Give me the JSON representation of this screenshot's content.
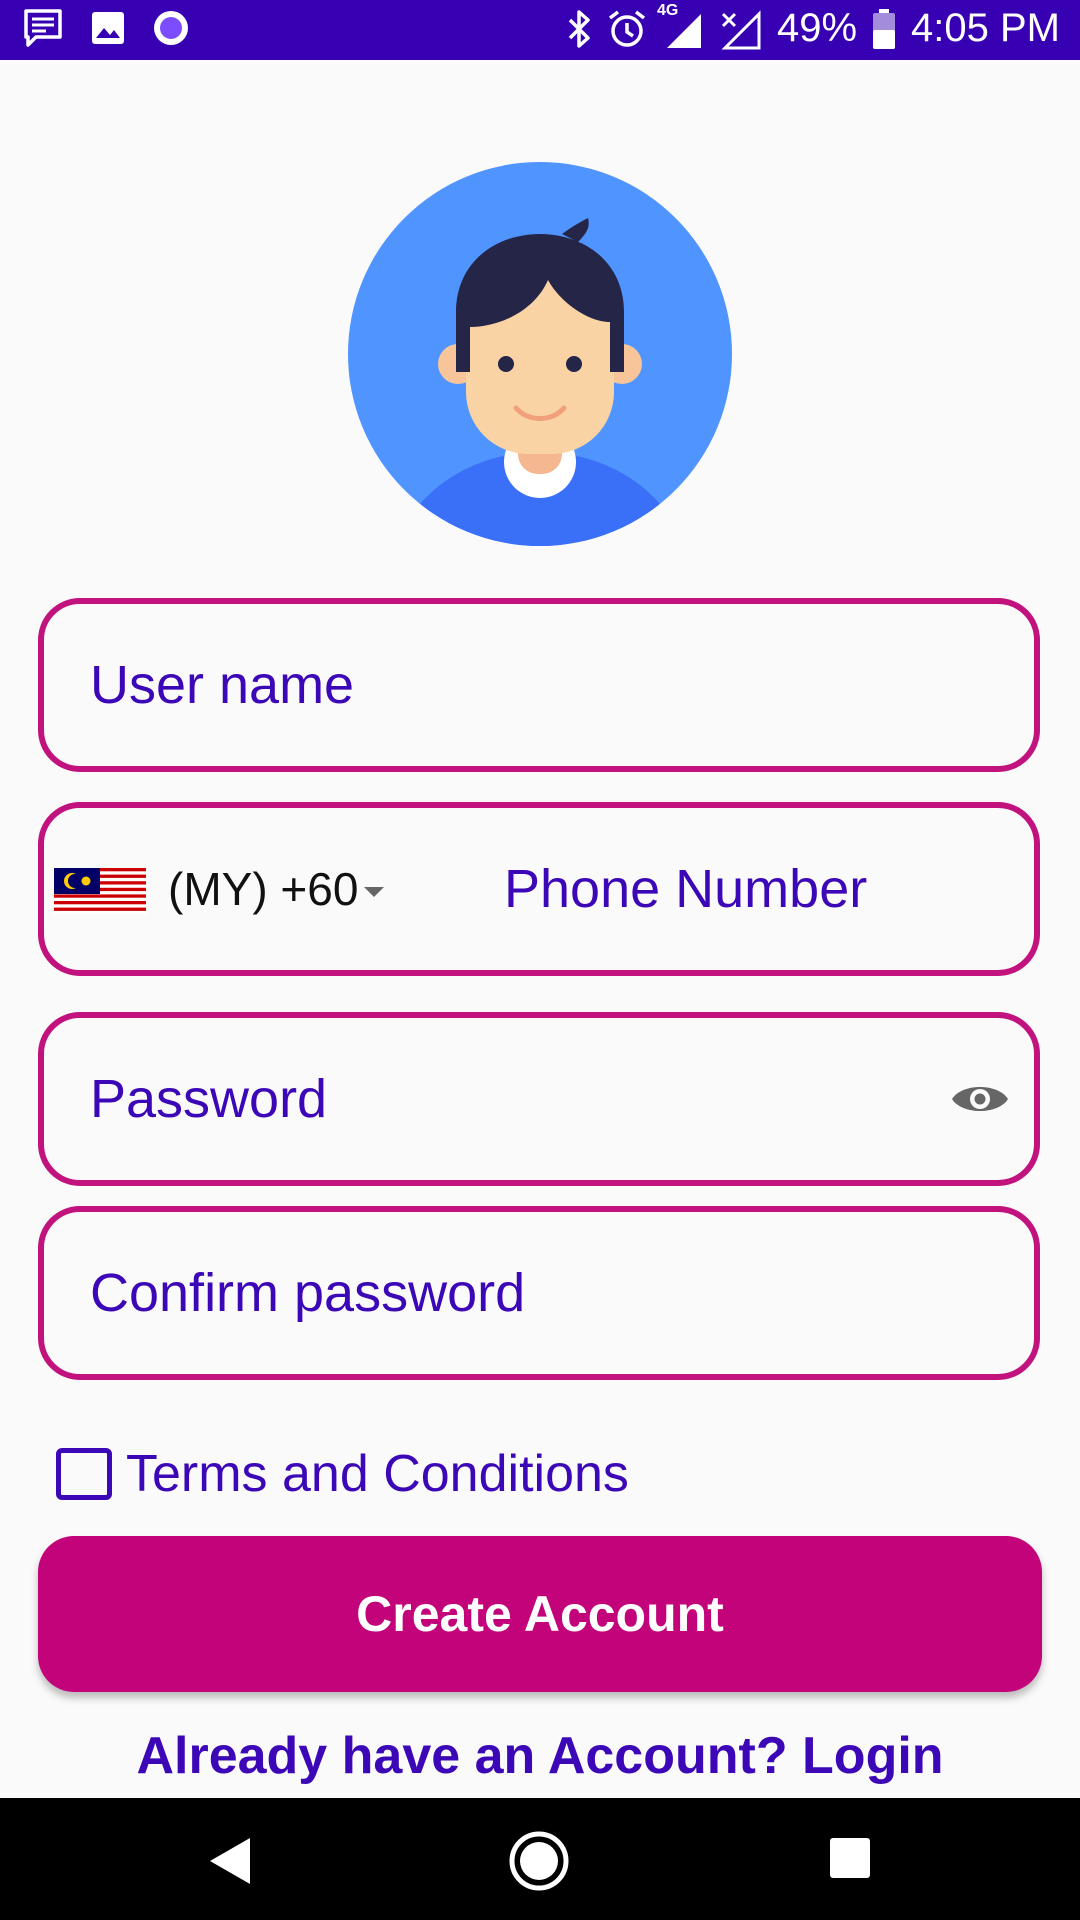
{
  "status_bar": {
    "battery": "49%",
    "time": "4:05 PM",
    "network": "4G",
    "icons": [
      "message-icon",
      "image-icon",
      "assistant-icon",
      "bluetooth-icon",
      "alarm-icon",
      "signal-icon",
      "signal-x-icon",
      "battery-icon"
    ]
  },
  "form": {
    "username_placeholder": "User name",
    "country_code": "(MY) +60",
    "phone_placeholder": "Phone Number",
    "password_placeholder": "Password",
    "confirm_placeholder": "Confirm password",
    "terms_label": "Terms and Conditions",
    "terms_checked": false,
    "create_button": "Create Account",
    "login_link": "Already have an Account? Login"
  },
  "colors": {
    "status_bar": "#3700B3",
    "accent_magenta": "#C2127D",
    "button": "#C2037A",
    "text_indigo": "#3C07B6",
    "avatar_bg": "#4F94FF"
  }
}
